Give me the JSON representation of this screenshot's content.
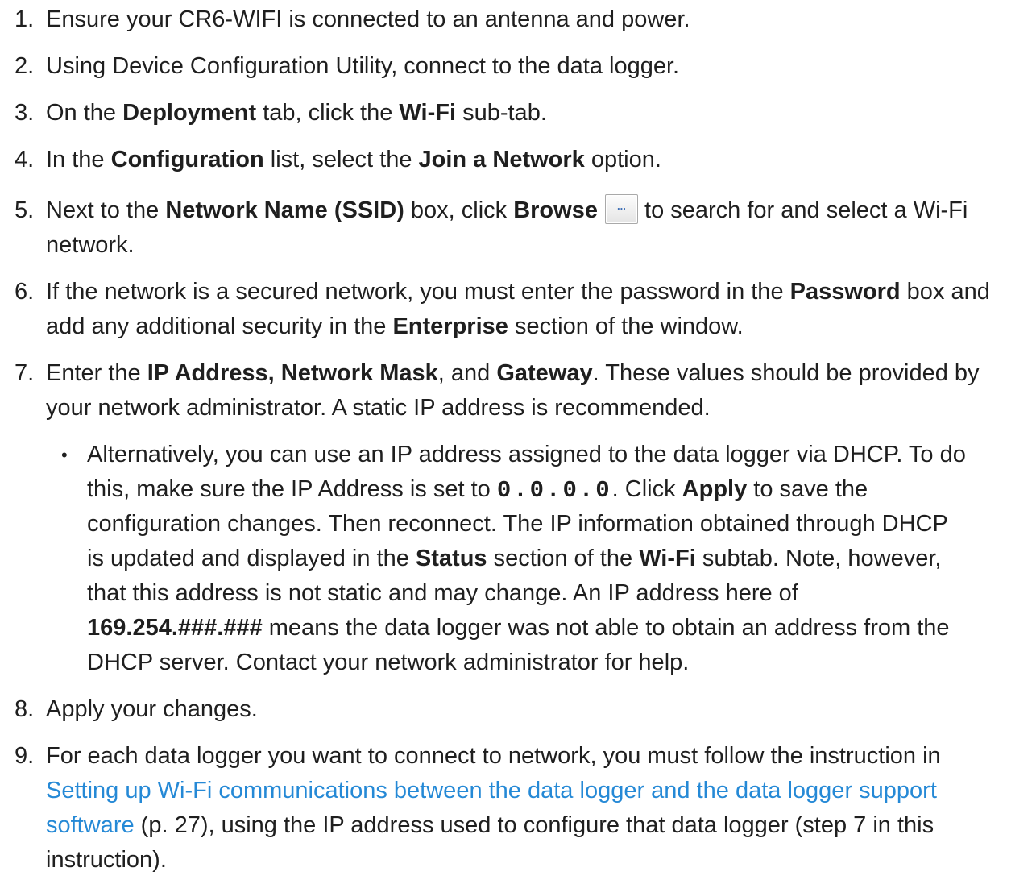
{
  "colors": {
    "text": "#1f1f1f",
    "link": "#2589d6",
    "button_dots": "#3b6db5"
  },
  "steps": [
    {
      "number": "1.",
      "lines": [
        [
          {
            "text": "Ensure your CR6-WIFI is connected to an antenna and power."
          }
        ]
      ]
    },
    {
      "number": "2.",
      "lines": [
        [
          {
            "text": "Using Device Configuration Utility, connect to the data logger."
          }
        ]
      ]
    },
    {
      "number": "3.",
      "lines": [
        [
          {
            "text": "On the "
          },
          {
            "text": "Deployment",
            "bold": true
          },
          {
            "text": " tab, click the "
          },
          {
            "text": "Wi-Fi",
            "bold": true
          },
          {
            "text": " sub-tab."
          }
        ]
      ]
    },
    {
      "number": "4.",
      "lines": [
        [
          {
            "text": "In the "
          },
          {
            "text": "Configuration",
            "bold": true
          },
          {
            "text": " list, select the "
          },
          {
            "text": "Join a Network",
            "bold": true
          },
          {
            "text": " option."
          }
        ]
      ]
    },
    {
      "number": "5.",
      "lines": [
        [
          {
            "text": "Next to the "
          },
          {
            "text": "Network Name (SSID)",
            "bold": true
          },
          {
            "text": " box, click "
          },
          {
            "text": "Browse",
            "bold": true
          },
          {
            "icon": "browse-button-icon",
            "label": "..."
          },
          {
            "text": " to search for and select a Wi-Fi"
          }
        ],
        [
          {
            "text": "network."
          }
        ]
      ]
    },
    {
      "number": "6.",
      "lines": [
        [
          {
            "text": "If the network is a secured network, you must enter the password in the "
          },
          {
            "text": "Password",
            "bold": true
          },
          {
            "text": " box and"
          }
        ],
        [
          {
            "text": "add any additional security in the "
          },
          {
            "text": "Enterprise",
            "bold": true
          },
          {
            "text": " section of the window."
          }
        ]
      ]
    },
    {
      "number": "7.",
      "lines": [
        [
          {
            "text": "Enter the "
          },
          {
            "text": "IP Address, Network Mask",
            "bold": true
          },
          {
            "text": ", and "
          },
          {
            "text": "Gateway",
            "bold": true
          },
          {
            "text": ". These values should be provided by"
          }
        ],
        [
          {
            "text": "your network administrator. A static IP address is recommended."
          }
        ]
      ],
      "bullet": {
        "marker": "•",
        "lines": [
          [
            {
              "text": "Alternatively, you can use an IP address assigned to the data logger via DHCP. To do"
            }
          ],
          [
            {
              "text": "this, make sure the IP Address is set to "
            },
            {
              "text": "0.0.0.0",
              "code": true
            },
            {
              "text": ". Click "
            },
            {
              "text": "Apply",
              "bold": true
            },
            {
              "text": " to save the"
            }
          ],
          [
            {
              "text": "configuration changes. Then reconnect. The IP information obtained through DHCP"
            }
          ],
          [
            {
              "text": "is updated and displayed in the "
            },
            {
              "text": "Status",
              "bold": true
            },
            {
              "text": " section of the "
            },
            {
              "text": "Wi-Fi",
              "bold": true
            },
            {
              "text": " subtab. Note, however,"
            }
          ],
          [
            {
              "text": "that this address is not static and may change. An IP address here of"
            }
          ],
          [
            {
              "text": "169.254.###.###",
              "bold": true
            },
            {
              "text": " means the data logger was not able to obtain an address from the"
            }
          ],
          [
            {
              "text": "DHCP server. Contact your network administrator for help."
            }
          ]
        ]
      }
    },
    {
      "number": "8.",
      "lines": [
        [
          {
            "text": "Apply your changes."
          }
        ]
      ]
    },
    {
      "number": "9.",
      "lines": [
        [
          {
            "text": "For each data logger you want to connect to network, you must follow the instruction in"
          }
        ],
        [
          {
            "text": "Setting up Wi-Fi communications between the data logger and the data logger support",
            "link": true
          }
        ],
        [
          {
            "text": "software",
            "link": true
          },
          {
            "text": " (p. 27), using the IP address used to configure that data logger (step 7 in this"
          }
        ],
        [
          {
            "text": "instruction)."
          }
        ]
      ]
    }
  ]
}
